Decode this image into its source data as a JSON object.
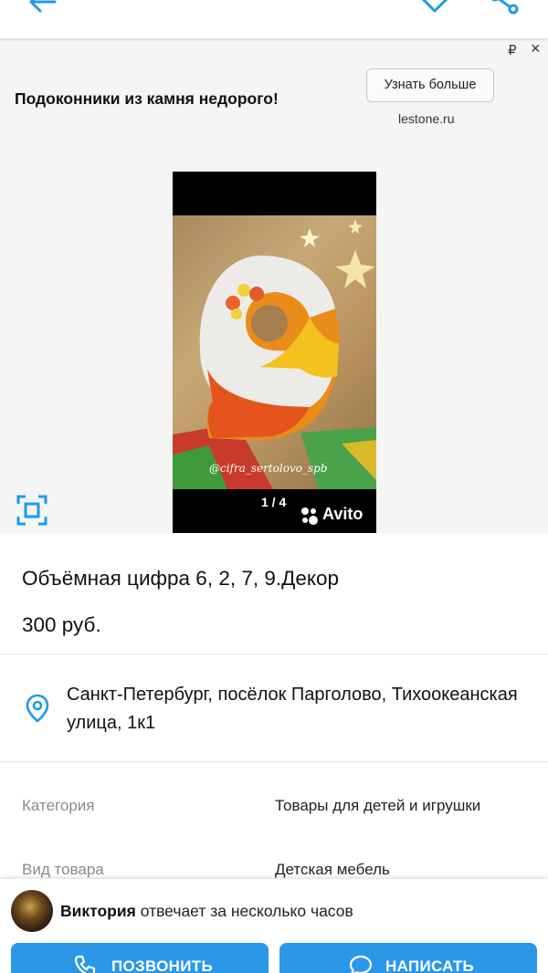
{
  "header": {
    "icons": [
      "back-arrow-icon",
      "heart-icon",
      "share-icon"
    ]
  },
  "ad": {
    "currency_symbol": "₽",
    "close_symbol": "×",
    "headline": "Подоконники из камня недорого!",
    "button_label": "Узнать больше",
    "domain": "lestone.ru"
  },
  "gallery": {
    "counter": "1 / 4",
    "brand": "Avito",
    "watermark": "@cifra_sertolovo_spb"
  },
  "listing": {
    "title": "Объёмная цифра 6, 2, 7, 9.Декор",
    "price": "300 руб.",
    "address": "Санкт-Петербург, посёлок Парголово, Тихоокеанская улица, 1к1"
  },
  "params": [
    {
      "label": "Категория",
      "value": "Товары для детей и игрушки"
    },
    {
      "label": "Вид товара",
      "value": "Детская мебель"
    }
  ],
  "contact": {
    "seller_name": "Виктория",
    "response_time": "отвечает за несколько часов",
    "call_label": "ПОЗВОНИТЬ",
    "write_label": "НАПИСАТЬ"
  },
  "colors": {
    "accent": "#2b97e7",
    "icon_blue": "#1e9be8"
  }
}
